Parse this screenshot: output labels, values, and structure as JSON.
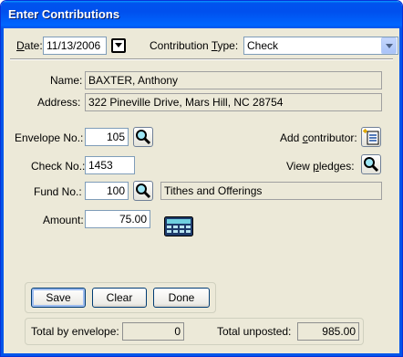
{
  "window": {
    "title": "Enter Contributions"
  },
  "header": {
    "date_label_prefix": "D",
    "date_label_rest": "ate:",
    "date_value": "11/13/2006",
    "type_label_prefix": "Contribution ",
    "type_label_accel": "T",
    "type_label_rest": "ype:",
    "type_value": "Check"
  },
  "contributor": {
    "name_label": "Name:",
    "name_value": "BAXTER, Anthony",
    "address_label": "Address:",
    "address_value": "322 Pineville Drive, Mars Hill, NC 28754"
  },
  "form": {
    "envelope_label": "Envelope No.:",
    "envelope_value": "105",
    "check_label": "Check No.:",
    "check_value": "1453",
    "fund_label": "Fund No.:",
    "fund_value": "100",
    "fund_name": "Tithes and Offerings",
    "amount_label": "Amount:",
    "amount_value": "75.00",
    "add_contributor_prefix": "Add ",
    "add_contributor_accel": "c",
    "add_contributor_rest": "ontributor:",
    "view_pledges_prefix": "View ",
    "view_pledges_accel": "p",
    "view_pledges_rest": "ledges:"
  },
  "buttons": {
    "save": "Save",
    "clear": "Clear",
    "done": "Done"
  },
  "totals": {
    "by_envelope_label": "Total by envelope:",
    "by_envelope_value": "0",
    "unposted_label": "Total unposted:",
    "unposted_value": "985.00"
  },
  "icons": {
    "search": "search-icon",
    "add_contributor": "add-contributor-icon",
    "calculator": "calculator-icon",
    "calendar_dropdown": "calendar-dropdown-icon"
  },
  "colors": {
    "title_bar": "#0055ea",
    "window_bg": "#ece9d8",
    "field_border": "#7f9db9"
  }
}
